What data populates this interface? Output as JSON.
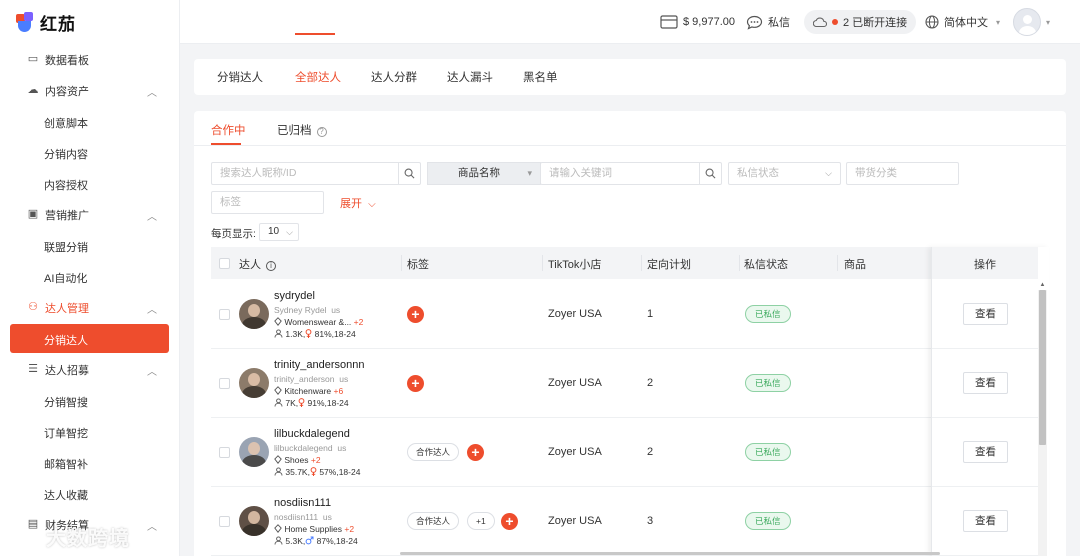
{
  "app": {
    "name": "红茄"
  },
  "sidebar": {
    "items": [
      {
        "type": "item",
        "label": "数据看板",
        "icon": "monitor-icon"
      },
      {
        "type": "group",
        "label": "内容资产",
        "icon": "cloud-icon",
        "expanded": true
      },
      {
        "type": "sub",
        "label": "创意脚本"
      },
      {
        "type": "sub",
        "label": "分销内容"
      },
      {
        "type": "sub",
        "label": "内容授权"
      },
      {
        "type": "group",
        "label": "营销推广",
        "icon": "box-icon",
        "expanded": true
      },
      {
        "type": "sub",
        "label": "联盟分销"
      },
      {
        "type": "sub",
        "label": "AI自动化"
      },
      {
        "type": "group",
        "label": "达人管理",
        "icon": "people-icon",
        "expanded": true,
        "active": true
      },
      {
        "type": "sub",
        "label": "分销达人",
        "active": true
      },
      {
        "type": "group",
        "label": "达人招募",
        "icon": "document-icon",
        "expanded": true
      },
      {
        "type": "sub",
        "label": "分销智搜"
      },
      {
        "type": "sub",
        "label": "订单智挖"
      },
      {
        "type": "sub",
        "label": "邮箱智补"
      },
      {
        "type": "sub",
        "label": "达人收藏"
      },
      {
        "type": "group",
        "label": "财务结算",
        "icon": "wallet-icon",
        "expanded": true
      }
    ]
  },
  "header": {
    "balance": "$ 9,977.00",
    "messages_label": "私信",
    "connection_label": "2 已断开连接",
    "language_label": "简体中文"
  },
  "top_tabs": [
    "分销达人",
    "全部达人",
    "达人分群",
    "达人漏斗",
    "黑名单"
  ],
  "top_tab_active": 1,
  "sub_tabs": {
    "active": "合作中",
    "archived": "已归档"
  },
  "filters": {
    "search_placeholder": "搜索达人昵称/ID",
    "product_select": "商品名称",
    "keyword_placeholder": "请输入关键词",
    "dm_status_placeholder": "私信状态",
    "category_placeholder": "带货分类",
    "tag_placeholder": "标签",
    "expand_label": "展开"
  },
  "pagination": {
    "label": "每页显示:",
    "value": "10"
  },
  "table": {
    "columns": {
      "creator": "达人",
      "tags": "标签",
      "shop": "TikTok小店",
      "plan": "定向计划",
      "dm_status": "私信状态",
      "product": "商品",
      "actions": "操作"
    },
    "rows": [
      {
        "name": "sydrydel",
        "handle": "Sydney Rydel",
        "region": "us",
        "category": "Womenswear &...",
        "category_more": "+2",
        "followers": "1.3K,",
        "gender_pct": "81%,18-24",
        "gender": "female",
        "tags": [],
        "shop": "Zoyer USA",
        "plan": "1",
        "dm_status": "已私信",
        "action": "查看",
        "avatar_color": "#7a6a5c"
      },
      {
        "name": "trinity_andersonnn",
        "handle": "trinity_anderson",
        "region": "us",
        "category": "Kitchenware",
        "category_more": "+6",
        "followers": "7K,",
        "gender_pct": "91%,18-24",
        "gender": "female",
        "tags": [],
        "shop": "Zoyer USA",
        "plan": "2",
        "dm_status": "已私信",
        "action": "查看",
        "avatar_color": "#8c7b6a"
      },
      {
        "name": "lilbuckdalegend",
        "handle": "lilbuckdalegend",
        "region": "us",
        "category": "Shoes",
        "category_more": "+2",
        "followers": "35.7K,",
        "gender_pct": "57%,18-24",
        "gender": "female",
        "tags": [
          "合作达人"
        ],
        "shop": "Zoyer USA",
        "plan": "2",
        "dm_status": "已私信",
        "action": "查看",
        "avatar_color": "#9aa4b3"
      },
      {
        "name": "nosdiisn111",
        "handle": "nosdiisn111",
        "region": "us",
        "category": "Home Supplies",
        "category_more": "+2",
        "followers": "5.3K,",
        "gender_pct": "87%,18-24",
        "gender": "male",
        "tags": [
          "合作达人",
          "+1"
        ],
        "shop": "Zoyer USA",
        "plan": "3",
        "dm_status": "已私信",
        "action": "查看",
        "avatar_color": "#5f5046"
      }
    ]
  },
  "watermark": "大数跨境",
  "colors": {
    "accent": "#ee4d2d",
    "success": "#3aa95c"
  }
}
